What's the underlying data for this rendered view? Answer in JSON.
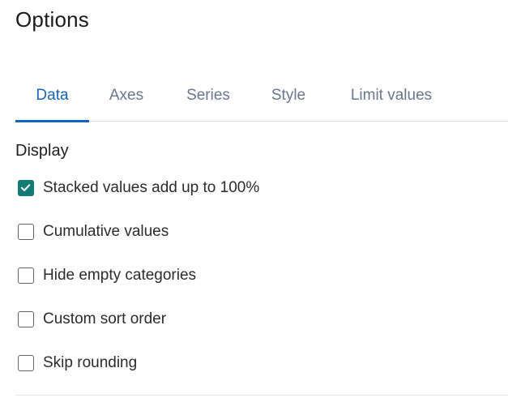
{
  "panel": {
    "title": "Options"
  },
  "tabs": [
    {
      "label": "Data",
      "active": true
    },
    {
      "label": "Axes",
      "active": false
    },
    {
      "label": "Series",
      "active": false
    },
    {
      "label": "Style",
      "active": false
    },
    {
      "label": "Limit values",
      "active": false
    }
  ],
  "display": {
    "heading": "Display",
    "options": [
      {
        "label": "Stacked values add up to 100%",
        "checked": true
      },
      {
        "label": "Cumulative values",
        "checked": false
      },
      {
        "label": "Hide empty categories",
        "checked": false
      },
      {
        "label": "Custom sort order",
        "checked": false
      },
      {
        "label": "Skip rounding",
        "checked": false
      }
    ]
  },
  "colors": {
    "accent": "#1565c0",
    "checkbox_checked": "#127b75",
    "tab_inactive": "#6b778c",
    "divider": "#d9dde2"
  },
  "icons": {
    "checkmark": "check-icon"
  }
}
